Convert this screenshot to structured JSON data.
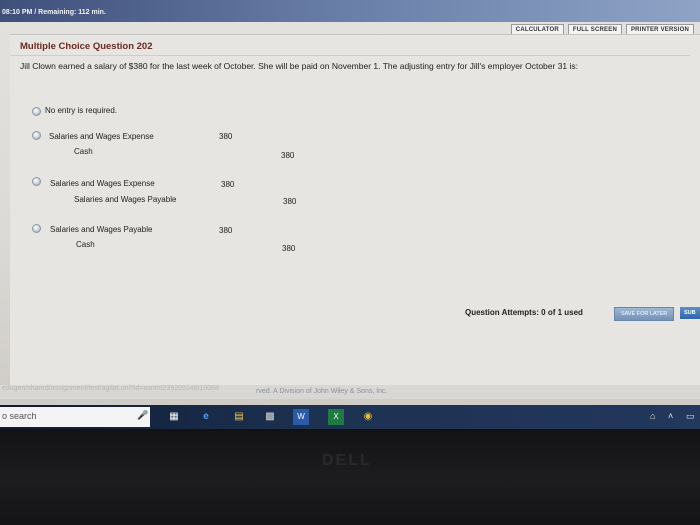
{
  "timer": "08:10 PM / Remaining: 112 min.",
  "toolbar": {
    "calculator": "CALCULATOR",
    "full_screen": "FULL SCREEN",
    "printer_version": "PRINTER VERSION"
  },
  "question": {
    "title": "Multiple Choice Question 202",
    "text": "Jill Clown earned a salary of $380 for the last week of October. She will be paid on November 1. The adjusting entry for Jill's employer October 31 is:"
  },
  "options": [
    {
      "label": "No entry is required."
    },
    {
      "debit_account": "Salaries and Wages Expense",
      "debit_amount": "380",
      "credit_account": "Cash",
      "credit_amount": "380"
    },
    {
      "debit_account": "Salaries and Wages Expense",
      "debit_amount": "380",
      "credit_account": "Salaries and Wages Payable",
      "credit_amount": "380"
    },
    {
      "debit_account": "Salaries and Wages Payable",
      "debit_amount": "380",
      "credit_account": "Cash",
      "credit_amount": "380"
    }
  ],
  "footer": {
    "attempts": "Question Attempts: 0 of 1 used",
    "save_later": "SAVE FOR LATER",
    "submit": "SUB",
    "status_url": "edugen/shared/assignment/test/agitat.uni?id=asnmt239205148t10088",
    "copyright": "rved. A Division of John Wiley & Sons, Inc."
  },
  "taskbar": {
    "search_placeholder": "o search",
    "icons": [
      "mic-icon",
      "task-view-icon",
      "edge-icon",
      "file-explorer-icon",
      "store-icon",
      "word-icon",
      "excel-icon",
      "chrome-icon"
    ]
  },
  "bezel": {
    "brand": "DELL"
  }
}
